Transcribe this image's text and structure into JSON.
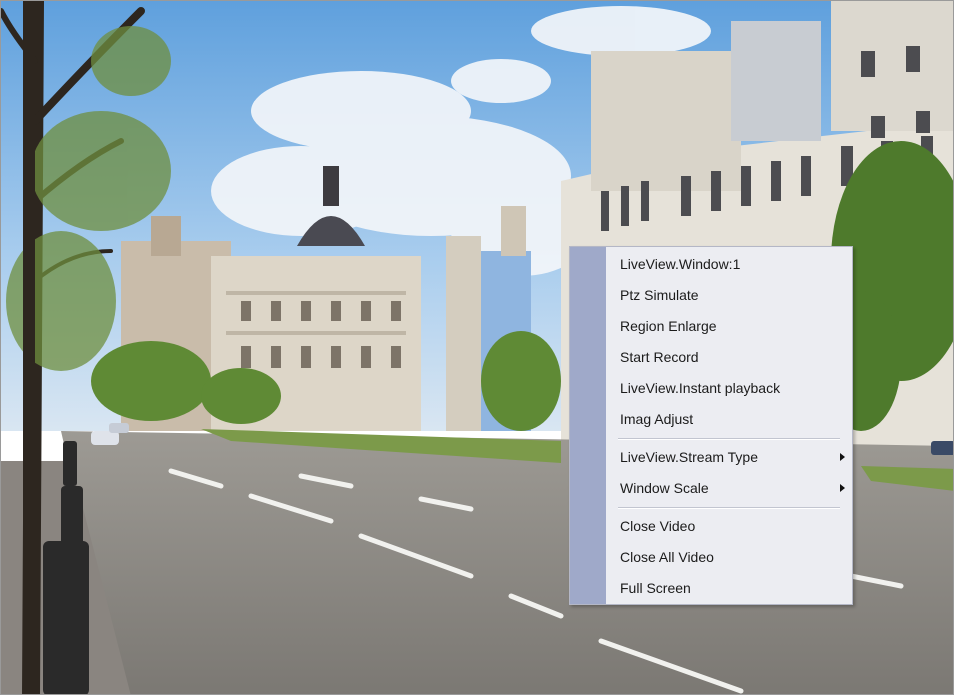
{
  "context_menu": {
    "items": [
      {
        "label": "LiveView.Window:1"
      },
      {
        "label": "Ptz Simulate"
      },
      {
        "label": "Region Enlarge"
      },
      {
        "label": "Start Record"
      },
      {
        "label": "LiveView.Instant playback"
      },
      {
        "label": "Imag Adjust"
      },
      {
        "label": "LiveView.Stream Type",
        "submenu": true
      },
      {
        "label": "Window Scale",
        "submenu": true
      },
      {
        "label": "Close Video"
      },
      {
        "label": "Close All Video"
      },
      {
        "label": "Full Screen"
      }
    ]
  },
  "colors": {
    "menu_background": "#ecedf2",
    "menu_gutter": "#9fa9c9",
    "menu_border": "#b4b7c6"
  }
}
